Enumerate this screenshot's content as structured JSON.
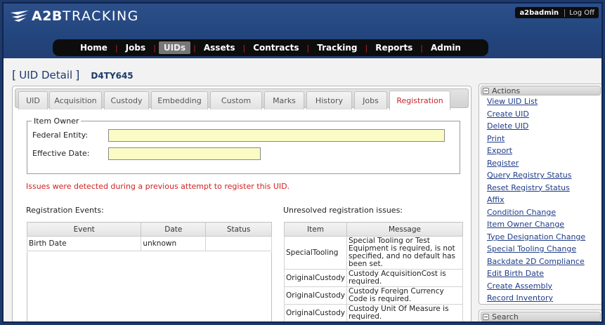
{
  "app": {
    "logo_strong": "A2B",
    "logo_light": "TRACKING"
  },
  "user": {
    "name": "a2badmin",
    "logoff": "Log Off"
  },
  "nav": [
    "Home",
    "Jobs",
    "UIDs",
    "Assets",
    "Contracts",
    "Tracking",
    "Reports",
    "Admin"
  ],
  "nav_active": "UIDs",
  "page": {
    "title": "UID Detail",
    "bracket_open": "[",
    "bracket_close": "]",
    "uid": "D4TY645"
  },
  "tabs": [
    "UID",
    "Acquisition",
    "Custody",
    "Embedding",
    "Custom",
    "Marks",
    "History",
    "Jobs",
    "Registration"
  ],
  "active_tab": "Registration",
  "owner": {
    "legend": "Item Owner",
    "federal_entity_label": "Federal Entity:",
    "federal_entity_value": "",
    "effective_date_label": "Effective Date:",
    "effective_date_value": ""
  },
  "warning": "Issues were detected during a previous attempt to register this UID.",
  "events": {
    "label": "Registration Events:",
    "columns": [
      "Event",
      "Date",
      "Status"
    ],
    "rows": [
      [
        "Birth Date",
        "unknown",
        ""
      ]
    ]
  },
  "issues": {
    "label": "Unresolved registration issues:",
    "columns": [
      "Item",
      "Message"
    ],
    "rows": [
      [
        "SpecialTooling",
        "Special Tooling or Test Equipment is required, is not specified, and no default has been set."
      ],
      [
        "OriginalCustody",
        "Custody AcquisitionCost is required."
      ],
      [
        "OriginalCustody",
        "Custody Foreign Currency Code is required."
      ],
      [
        "OriginalCustody",
        "Custody Unit Of Measure is required."
      ]
    ]
  },
  "actions": {
    "title": "Actions",
    "items": [
      "View UID List",
      "Create UID",
      "Delete UID",
      "Print",
      "Export",
      "Register",
      "Query Registry Status",
      "Reset Registry Status",
      "Affix",
      "Condition Change",
      "Item Owner Change",
      "Type Designation Change",
      "Special Tooling Change",
      "Backdate 2D Compliance",
      "Edit Birth Date",
      "Create Assembly",
      "Record Inventory"
    ]
  },
  "search": {
    "title": "Search"
  },
  "colors": {
    "header_blue": "#23457d",
    "link_blue": "#1f3c88",
    "warning_red": "#d42020",
    "input_yellow": "#fbfbc6"
  }
}
